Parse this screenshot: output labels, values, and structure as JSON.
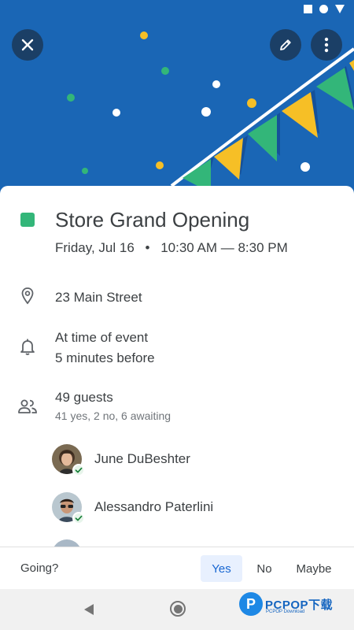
{
  "header": {
    "close_icon": "close-icon",
    "edit_icon": "pencil-icon",
    "more_icon": "more-vert-icon",
    "background_color": "#1a66b5"
  },
  "event": {
    "color": "#33b679",
    "title": "Store Grand Opening",
    "date": "Friday, Jul 16",
    "separator": "•",
    "time": "10:30 AM — 8:30 PM",
    "location": "23 Main Street",
    "reminders": [
      "At time of event",
      "5 minutes before"
    ],
    "guests_count": "49 guests",
    "guests_summary": "41 yes, 2 no, 6 awaiting",
    "guests": [
      {
        "name": "June DuBeshter",
        "status": "accepted"
      },
      {
        "name": "Alessandro Paterlini",
        "status": "accepted"
      }
    ]
  },
  "rsvp": {
    "prompt": "Going?",
    "yes": "Yes",
    "no": "No",
    "maybe": "Maybe",
    "selected": "Yes"
  },
  "watermark": {
    "text": "PCPOP下载",
    "sub": "PCPOP Download",
    "logo": "P"
  }
}
